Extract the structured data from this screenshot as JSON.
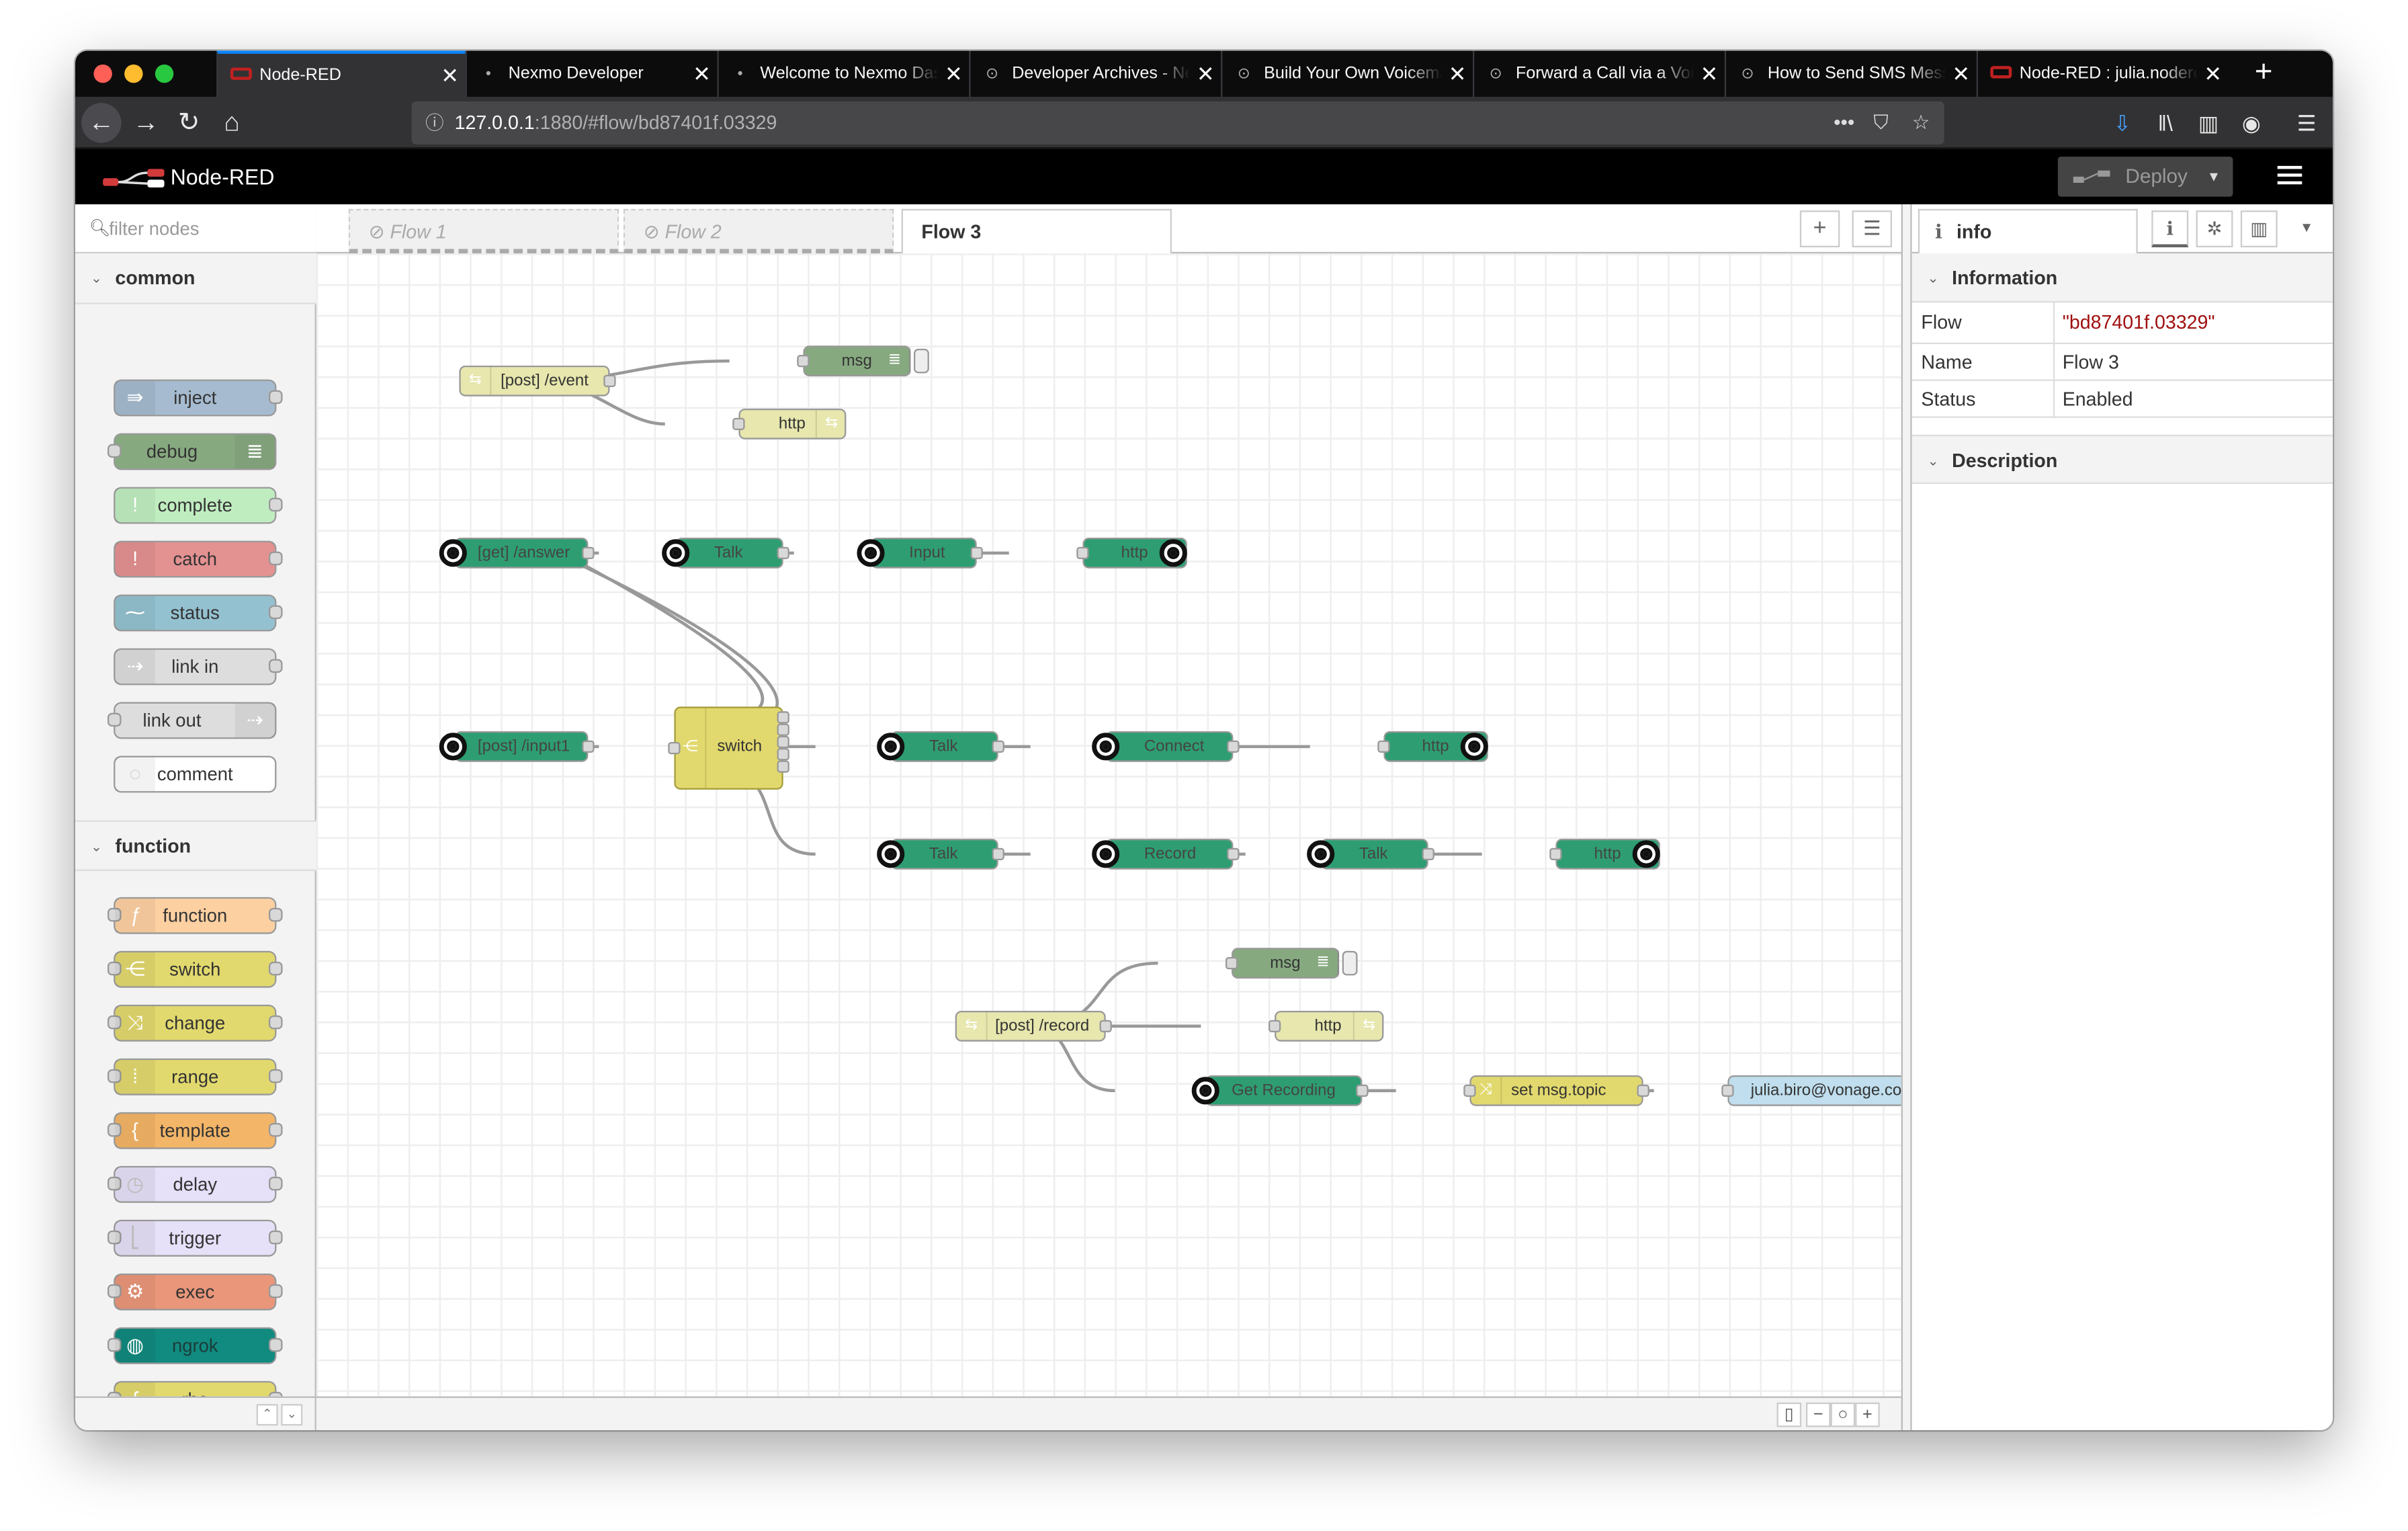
{
  "browser": {
    "tabs": [
      {
        "label": "Node-RED",
        "active": true
      },
      {
        "label": "Nexmo Developer"
      },
      {
        "label": "Welcome to Nexmo Dashboard"
      },
      {
        "label": "Developer Archives - Nexmo"
      },
      {
        "label": "Build Your Own Voicemail"
      },
      {
        "label": "Forward a Call via a Voice"
      },
      {
        "label": "How to Send SMS Messages"
      },
      {
        "label": "Node-RED : julia.nodered"
      }
    ],
    "url_host": "127.0.0.1",
    "url_path": ":1880/#flow/bd87401f.03329",
    "more_actions": "•••"
  },
  "header": {
    "title": "Node-RED",
    "deploy_label": "Deploy"
  },
  "palette": {
    "filter_placeholder": "filter nodes",
    "categories": [
      {
        "label": "common",
        "nodes": [
          "inject",
          "debug",
          "complete",
          "catch",
          "status",
          "link in",
          "link out",
          "comment"
        ]
      },
      {
        "label": "function",
        "nodes": [
          "function",
          "switch",
          "change",
          "range",
          "template",
          "delay",
          "trigger",
          "exec",
          "ngrok",
          "rbe"
        ]
      }
    ]
  },
  "workspace": {
    "tabs": [
      {
        "label": "Flow 1",
        "disabled": true
      },
      {
        "label": "Flow 2",
        "disabled": true
      },
      {
        "label": "Flow 3",
        "active": true
      }
    ],
    "nodes": {
      "post_event": "[post] /event",
      "msg1": "msg",
      "http1": "http",
      "get_answer": "[get] /answer",
      "talk1": "Talk",
      "input": "Input",
      "http2": "http",
      "post_input1": "[post] /input1",
      "switch": "switch",
      "talk2": "Talk",
      "connect": "Connect",
      "http3": "http",
      "talk3": "Talk",
      "record": "Record",
      "talk4": "Talk",
      "http4": "http",
      "msg2": "msg",
      "post_record": "[post] /record",
      "http5": "http",
      "get_recording": "Get Recording",
      "set_topic": "set msg.topic",
      "email": "julia.biro@vonage.com"
    }
  },
  "sidebar": {
    "tab_label": "info",
    "info_header": "Information",
    "rows": [
      {
        "key": "Flow",
        "value": "\"bd87401f.03329\""
      },
      {
        "key": "Name",
        "value": "Flow 3"
      },
      {
        "key": "Status",
        "value": "Enabled"
      }
    ],
    "description_header": "Description"
  },
  "colors": {
    "nexmo_green": "#2e9e72",
    "http_in": "#e7e7ae",
    "debug": "#87a980",
    "switch": "#e2d96e",
    "change": "#e2d96e",
    "email": "#c0deed"
  }
}
